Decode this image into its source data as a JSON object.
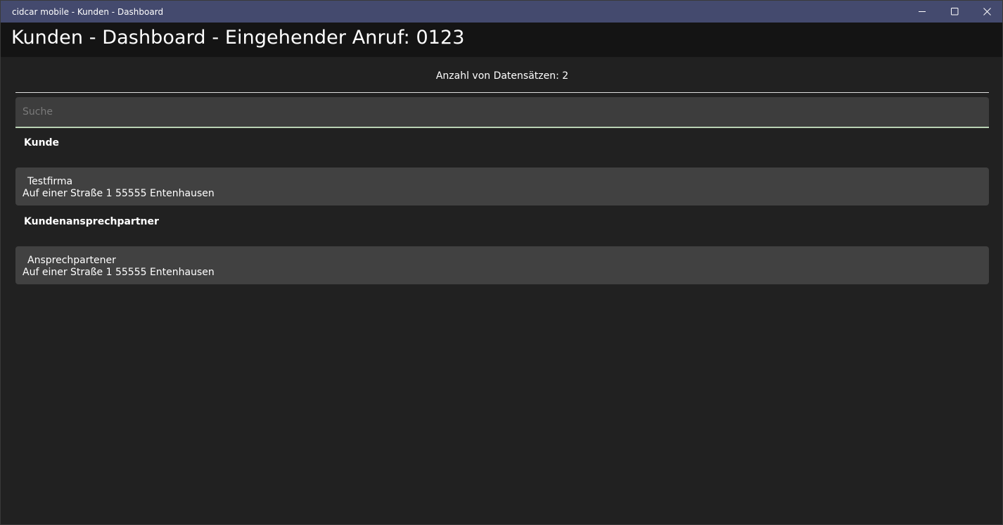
{
  "window": {
    "title": "cidcar mobile - Kunden - Dashboard",
    "controls": {
      "minimize_icon": "minimize-icon",
      "maximize_icon": "maximize-icon",
      "close_icon": "close-icon"
    }
  },
  "header": {
    "title": "Kunden - Dashboard - Eingehender Anruf: 0123"
  },
  "records": {
    "count_label": "Anzahl von Datensätzen: 2"
  },
  "search": {
    "placeholder": "Suche",
    "value": ""
  },
  "sections": [
    {
      "label": "Kunde",
      "items": [
        {
          "name": "Testfirma",
          "address": "Auf einer Straße 1 55555 Entenhausen"
        }
      ]
    },
    {
      "label": "Kundenansprechpartner",
      "items": [
        {
          "name": "Ansprechpartener",
          "address": "Auf einer Straße 1 55555 Entenhausen"
        }
      ]
    }
  ],
  "colors": {
    "titlebar": "#444a6e",
    "header": "#141414",
    "background": "#212121",
    "card": "#414141",
    "search_underline": "#b9d2b4"
  }
}
